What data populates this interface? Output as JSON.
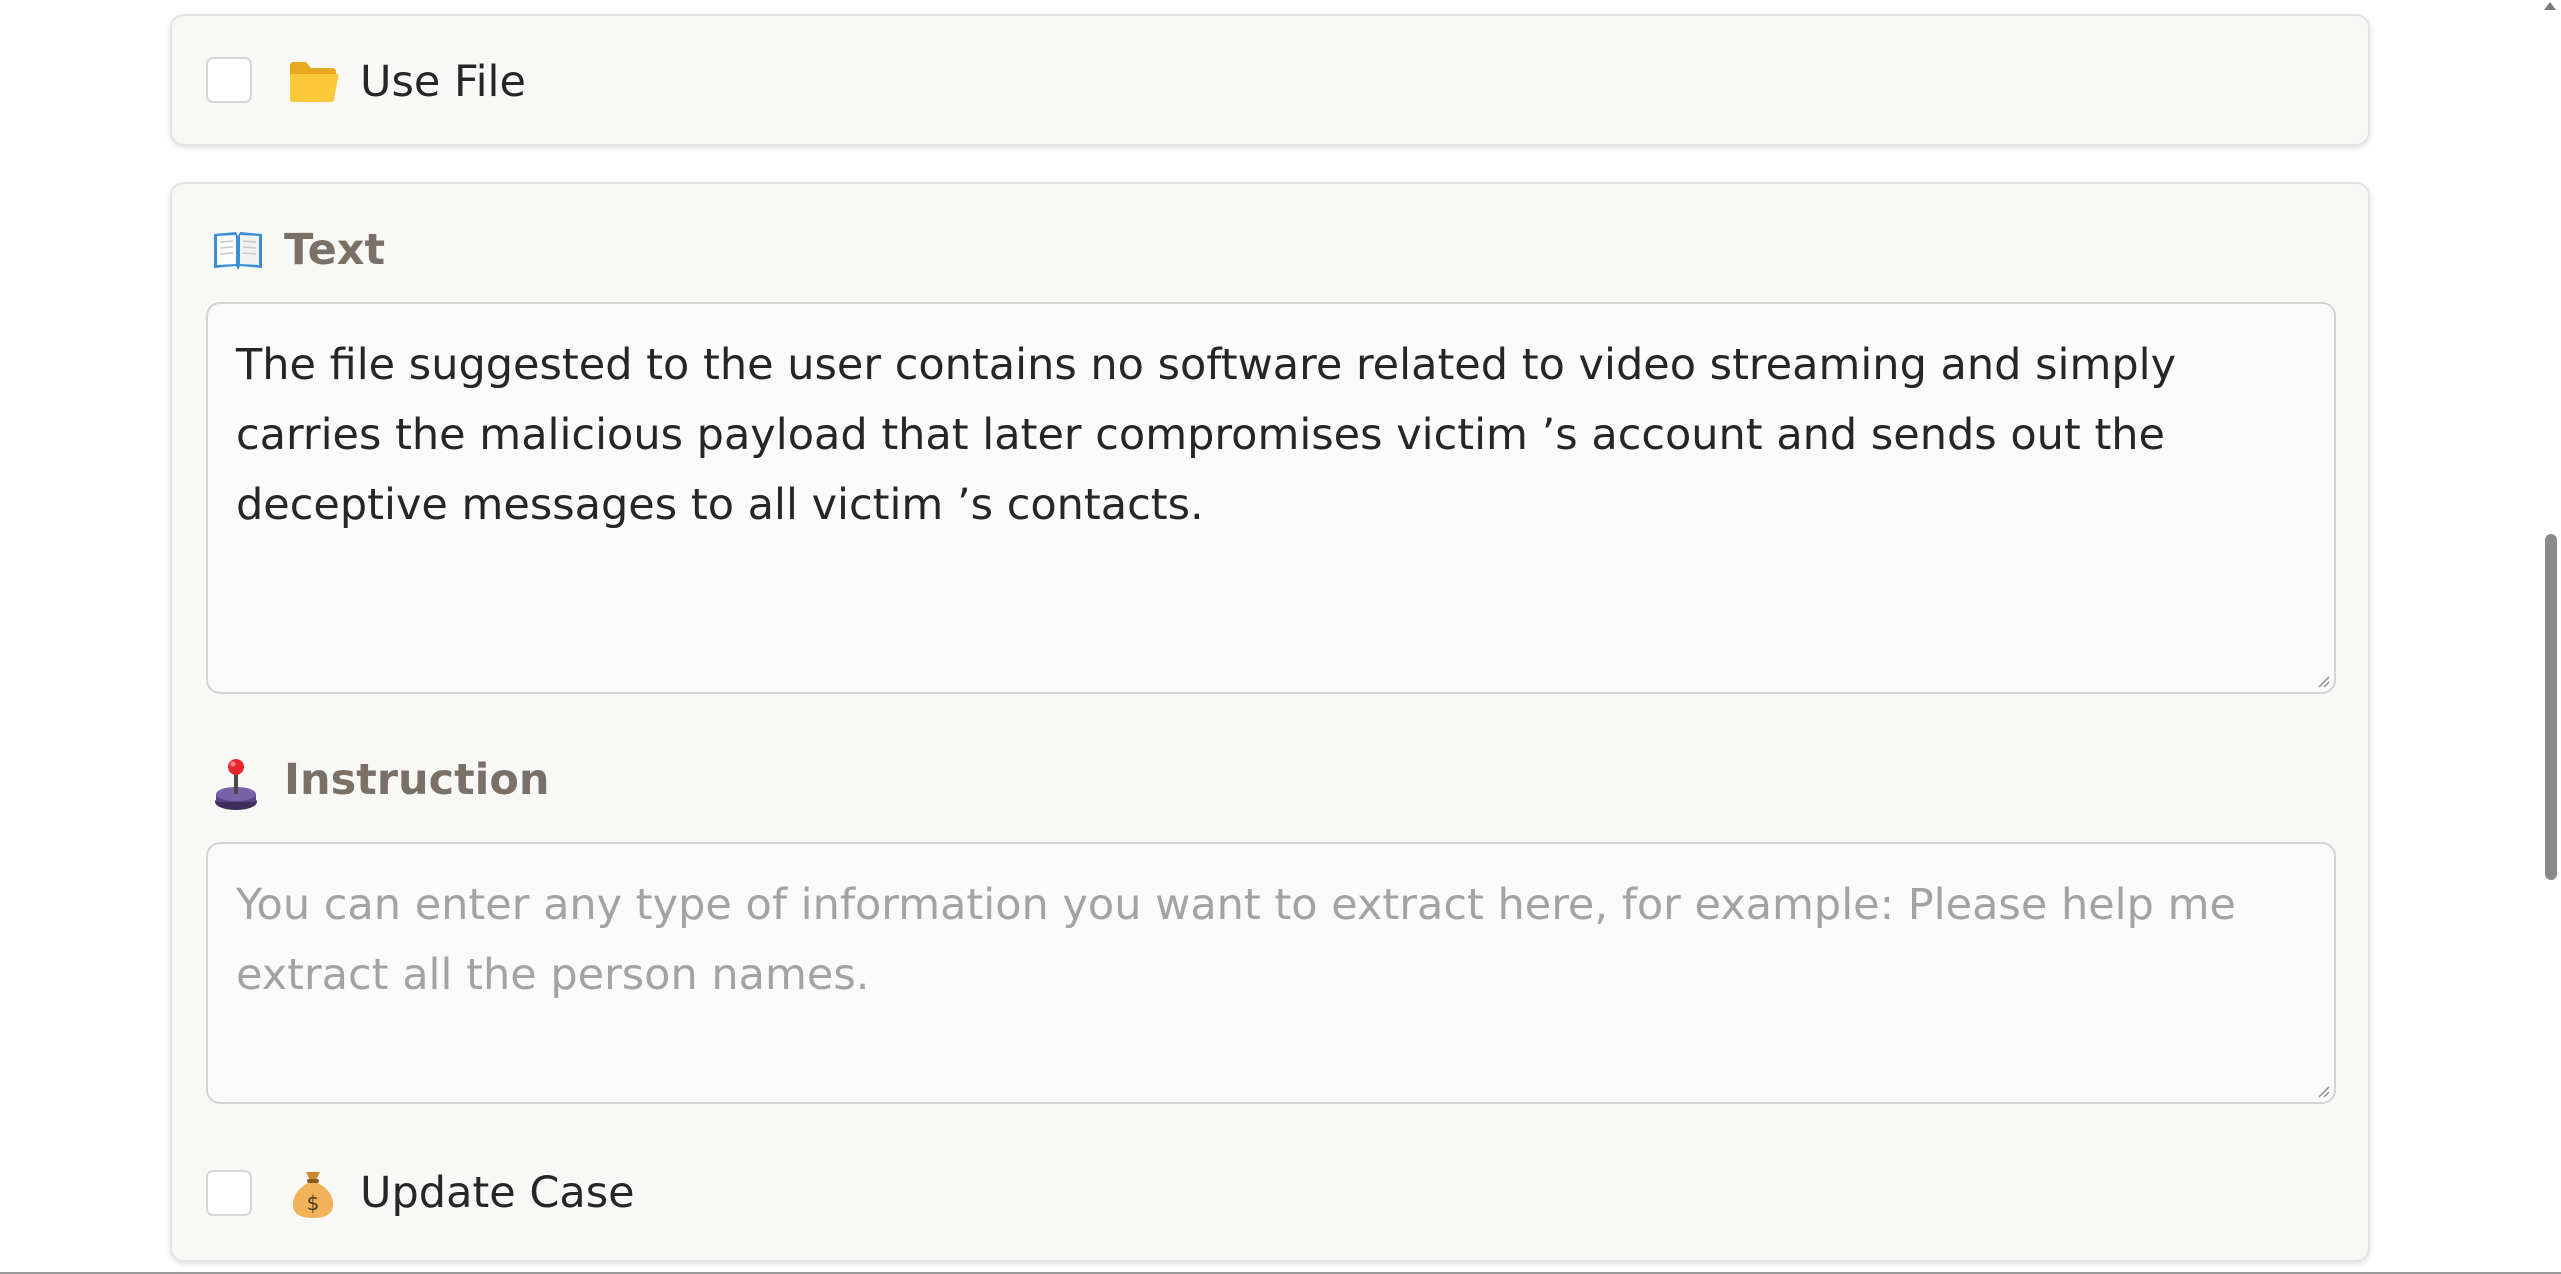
{
  "use_file": {
    "label": "Use File",
    "checked": false,
    "icon": "folder-icon"
  },
  "text_section": {
    "label": "Text",
    "icon": "open-book-icon",
    "value": "The file suggested to the user contains no software related to video streaming and simply carries the malicious payload that later compromises victim ’s account and sends out the deceptive messages to all victim ’s contacts."
  },
  "instruction_section": {
    "label": "Instruction",
    "icon": "joystick-icon",
    "value": "",
    "placeholder": "You can enter any type of information you want to extract here, for example: Please help me extract all the person names."
  },
  "update_case": {
    "label": "Update Case",
    "checked": false,
    "icon": "money-bag-icon"
  },
  "colors": {
    "panel_bg": "#f8f8f7",
    "section_label": "#7a7068",
    "placeholder": "#a3a3a3"
  }
}
